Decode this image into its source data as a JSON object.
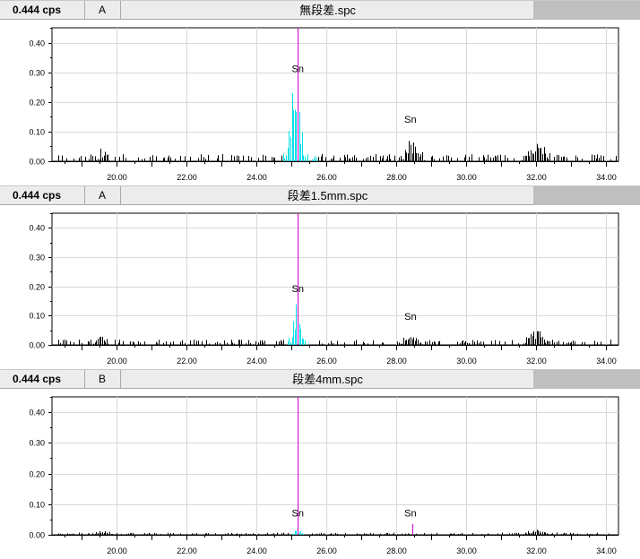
{
  "chart_data": [
    {
      "type": "bar",
      "header": {
        "cps": "0.444 cps",
        "channel": "A",
        "filename": "無段差.spc"
      },
      "xlim": [
        18.15,
        34.35
      ],
      "ylim": [
        0,
        0.45
      ],
      "xticks": [
        "20.00",
        "22.00",
        "24.00",
        "26.00",
        "28.00",
        "30.00",
        "32.00",
        "34.00"
      ],
      "yticks": [
        "0.00",
        "0.10",
        "0.20",
        "0.30",
        "0.40"
      ],
      "marker_x": 25.18,
      "annotations": [
        {
          "text": "Sn",
          "x": 25.18,
          "y": 0.3
        },
        {
          "text": "Sn",
          "x": 28.4,
          "y": 0.13
        }
      ],
      "colors": {
        "spectrum": "#000000",
        "peak": "#00e0e8",
        "marker": "#cc00cc"
      },
      "peak_region": [
        24.75,
        25.75
      ],
      "peaks": [
        {
          "center": 25.1,
          "width": 0.25,
          "height": 0.24
        },
        {
          "center": 28.45,
          "width": 0.3,
          "height": 0.05
        },
        {
          "center": 32.0,
          "width": 0.35,
          "height": 0.05
        },
        {
          "center": 19.6,
          "width": 0.2,
          "height": 0.02
        }
      ],
      "noise": 0.02,
      "seed": 11
    },
    {
      "type": "bar",
      "header": {
        "cps": "0.444 cps",
        "channel": "A",
        "filename": "段差1.5mm.spc"
      },
      "xlim": [
        18.15,
        34.35
      ],
      "ylim": [
        0,
        0.45
      ],
      "xticks": [
        "20.00",
        "22.00",
        "24.00",
        "26.00",
        "28.00",
        "30.00",
        "32.00",
        "34.00"
      ],
      "yticks": [
        "0.00",
        "0.10",
        "0.20",
        "0.30",
        "0.40"
      ],
      "marker_x": 25.18,
      "annotations": [
        {
          "text": "Sn",
          "x": 25.18,
          "y": 0.18
        },
        {
          "text": "Sn",
          "x": 28.4,
          "y": 0.085
        }
      ],
      "colors": {
        "spectrum": "#000000",
        "peak": "#00e0e8",
        "marker": "#cc00cc"
      },
      "peak_region": [
        24.85,
        25.55
      ],
      "peaks": [
        {
          "center": 25.15,
          "width": 0.2,
          "height": 0.11
        },
        {
          "center": 28.4,
          "width": 0.3,
          "height": 0.025
        },
        {
          "center": 32.0,
          "width": 0.35,
          "height": 0.04
        },
        {
          "center": 19.55,
          "width": 0.2,
          "height": 0.035
        }
      ],
      "noise": 0.015,
      "seed": 29
    },
    {
      "type": "bar",
      "header": {
        "cps": "0.444 cps",
        "channel": "B",
        "filename": "段差4mm.spc"
      },
      "xlim": [
        18.15,
        34.35
      ],
      "ylim": [
        0,
        0.45
      ],
      "xticks": [
        "20.00",
        "22.00",
        "24.00",
        "26.00",
        "28.00",
        "30.00",
        "32.00",
        "34.00"
      ],
      "yticks": [
        "0.00",
        "0.10",
        "0.20",
        "0.30",
        "0.40"
      ],
      "marker_x": 25.18,
      "annotations": [
        {
          "text": "Sn",
          "x": 25.18,
          "y": 0.06
        },
        {
          "text": "Sn",
          "x": 28.4,
          "y": 0.06
        }
      ],
      "colors": {
        "spectrum": "#000000",
        "peak": "#00e0e8",
        "marker": "#cc00cc"
      },
      "peak_region": [
        24.95,
        25.45
      ],
      "peaks": [
        {
          "center": 25.2,
          "width": 0.2,
          "height": 0.012
        },
        {
          "center": 32.0,
          "width": 0.5,
          "height": 0.01
        },
        {
          "center": 19.6,
          "width": 0.3,
          "height": 0.008
        }
      ],
      "line_peak": {
        "x": 28.45,
        "height": 0.035
      },
      "noise": 0.006,
      "seed": 53
    }
  ]
}
